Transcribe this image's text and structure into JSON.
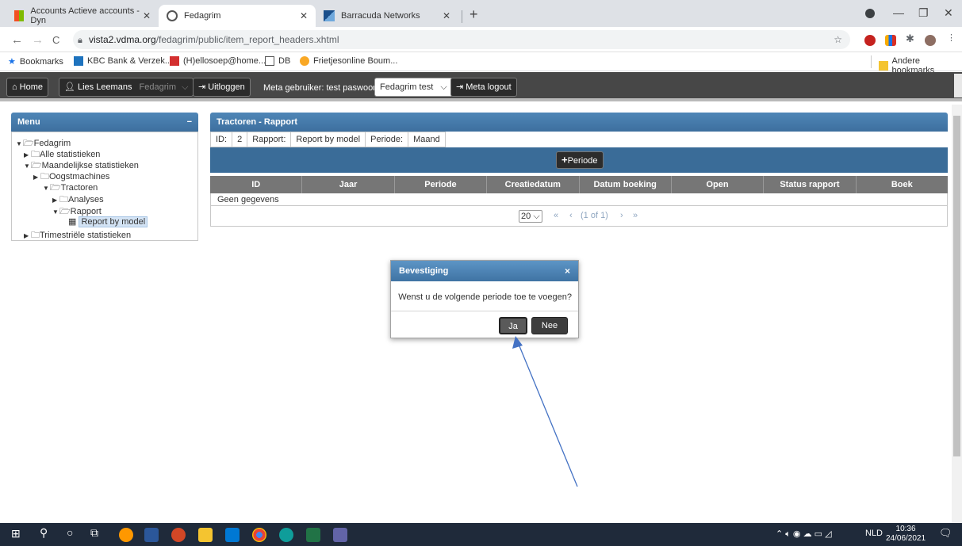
{
  "browser": {
    "tabs": [
      {
        "title": "Accounts Actieve accounts - Dyn"
      },
      {
        "title": "Fedagrim"
      },
      {
        "title": "Barracuda Networks"
      }
    ],
    "url_host": "vista2.vdma.org",
    "url_path": "/fedagrim/public/item_report_headers.xhtml",
    "bookmarks": [
      "Bookmarks",
      "KBC Bank & Verzek...",
      "(H)ellosoep@home...",
      "DB",
      "Frietjesonline Boum..."
    ],
    "other_bookmarks": "Andere bookmarks"
  },
  "toolbar": {
    "home": "Home",
    "user": "Lies Leemans",
    "org": "Fedagrim",
    "logout": "Uitloggen",
    "meta_user": "Meta gebruiker: test paswoord",
    "meta_select": "Fedagrim test",
    "meta_logout": "Meta logout"
  },
  "menu": {
    "title": "Menu",
    "collapse": "−",
    "nodes": [
      "Fedagrim",
      "Alle statistieken",
      "Maandelijkse statistieken",
      "Oogstmachines",
      "Tractoren",
      "Analyses",
      "Rapport",
      "Report by model",
      "Trimestriële statistieken"
    ]
  },
  "report": {
    "title": "Tractoren - Rapport",
    "info": [
      "ID:",
      "2",
      "Rapport:",
      "Report by model",
      "Periode:",
      "Maand"
    ],
    "add_button": "Periode",
    "columns": [
      "ID",
      "Jaar",
      "Periode",
      "Creatiedatum",
      "Datum boeking",
      "Open",
      "Status rapport",
      "Boek"
    ],
    "empty": "Geen gegevens",
    "rows_per_page": "20",
    "page_info": "(1 of 1)",
    "pager_first": "«",
    "pager_prev": "‹",
    "pager_next": "›",
    "pager_last": "»"
  },
  "dialog": {
    "title": "Bevestiging",
    "close": "×",
    "message": "Wenst u de volgende periode toe te voegen?",
    "yes": "Ja",
    "no": "Nee"
  },
  "taskbar": {
    "lang": "NLD",
    "time": "10:36",
    "date": "24/06/2021"
  }
}
